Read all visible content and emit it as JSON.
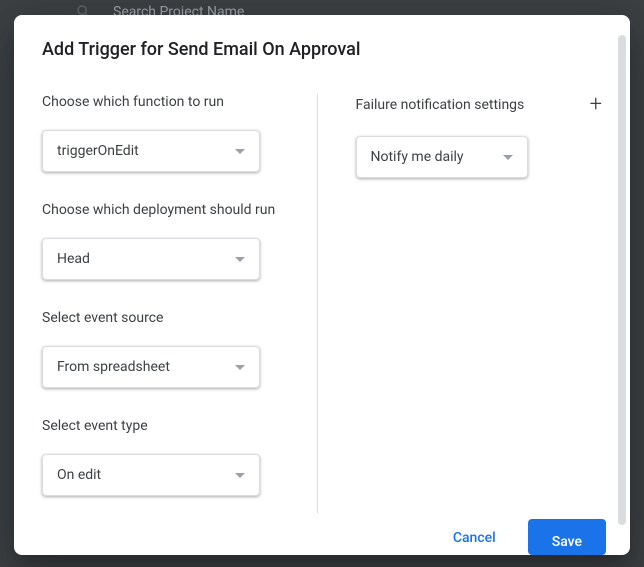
{
  "backdrop": {
    "search_placeholder": "Search Project Name"
  },
  "dialog": {
    "title": "Add Trigger for Send Email On Approval"
  },
  "left": {
    "function": {
      "label": "Choose which function to run",
      "value": "triggerOnEdit"
    },
    "deployment": {
      "label": "Choose which deployment should run",
      "value": "Head"
    },
    "event_source": {
      "label": "Select event source",
      "value": "From spreadsheet"
    },
    "event_type": {
      "label": "Select event type",
      "value": "On edit"
    }
  },
  "right": {
    "failure_notification": {
      "label": "Failure notification settings",
      "value": "Notify me daily"
    }
  },
  "footer": {
    "cancel": "Cancel",
    "save": "Save"
  }
}
